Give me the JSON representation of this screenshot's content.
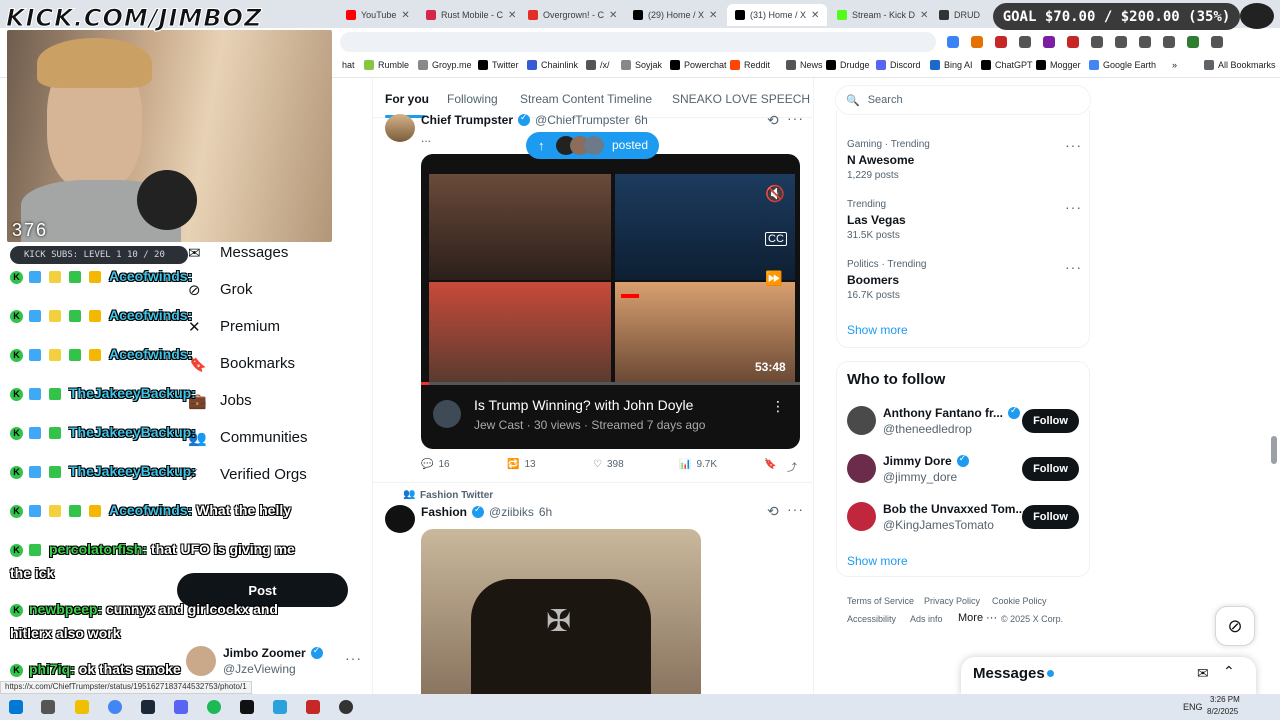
{
  "browser": {
    "tabs": [
      {
        "label": "YouTube",
        "color": "#ff0000",
        "active": false
      },
      {
        "label": "Rust Mobile - C",
        "color": "#d6264b",
        "active": false
      },
      {
        "label": "Overgrown! - C",
        "color": "#e52d27",
        "active": false
      },
      {
        "label": "(29) Home / X",
        "color": "#000000",
        "active": false
      },
      {
        "label": "(31) Home / X",
        "color": "#000000",
        "active": true
      },
      {
        "label": "Stream - Kick D",
        "color": "#53fc18",
        "active": false
      },
      {
        "label": "DRUD",
        "color": "#333333",
        "active": false
      }
    ],
    "bookmarks": [
      {
        "label": "hat",
        "color": "#888888"
      },
      {
        "label": "Rumble",
        "color": "#85c742"
      },
      {
        "label": "Groyp.me",
        "color": "#888888"
      },
      {
        "label": "Twitter",
        "color": "#000000"
      },
      {
        "label": "Chainlink",
        "color": "#375bd2"
      },
      {
        "label": "/x/",
        "color": "#555555"
      },
      {
        "label": "Soyjak",
        "color": "#888888"
      },
      {
        "label": "Powerchat",
        "color": "#000000"
      },
      {
        "label": "Reddit",
        "color": "#ff4500"
      },
      {
        "label": "News",
        "color": "#555555"
      },
      {
        "label": "Drudge",
        "color": "#000000"
      },
      {
        "label": "Discord",
        "color": "#5865f2"
      },
      {
        "label": "Bing AI",
        "color": "#1b6ac9"
      },
      {
        "label": "ChatGPT",
        "color": "#000000"
      },
      {
        "label": "Mogger",
        "color": "#000000"
      },
      {
        "label": "Google Earth",
        "color": "#4285f4"
      }
    ],
    "all_bookmarks": "All Bookmarks",
    "status_url": "https://x.com/ChiefTrumpster/status/1951627183744532753/photo/1"
  },
  "stream": {
    "logo_text": "KICK.COM/JIMBOZ",
    "viewers": "376",
    "subs_label": "KICK SUBS: LEVEL 1 10 / 20",
    "goal": "GOAL $70.00 / $200.00 (35%)",
    "goal_progress": 0.35,
    "chat": [
      {
        "user": "Aceofwinds:",
        "msg": "",
        "style": "cyan",
        "badges": [
          "#3fa9f5",
          "#f4d03f",
          "#33c24a",
          "#f5b800"
        ]
      },
      {
        "user": "Aceofwinds:",
        "msg": "",
        "style": "cyan",
        "badges": [
          "#3fa9f5",
          "#f4d03f",
          "#33c24a",
          "#f5b800"
        ]
      },
      {
        "user": "Aceofwinds:",
        "msg": "",
        "style": "cyan",
        "badges": [
          "#3fa9f5",
          "#f4d03f",
          "#33c24a",
          "#f5b800"
        ]
      },
      {
        "user": "TheJakeeyBackup:",
        "msg": "",
        "style": "cyan",
        "badges": [
          "#3fa9f5",
          "#33c24a"
        ]
      },
      {
        "user": "TheJakeeyBackup:",
        "msg": "",
        "style": "cyan",
        "badges": [
          "#3fa9f5",
          "#33c24a"
        ]
      },
      {
        "user": "TheJakeeyBackup:",
        "msg": "",
        "style": "cyan",
        "badges": [
          "#3fa9f5",
          "#33c24a"
        ]
      },
      {
        "user": "Aceofwinds:",
        "msg": "What the helly",
        "style": "cyan",
        "badges": [
          "#3fa9f5",
          "#f4d03f",
          "#33c24a",
          "#f5b800"
        ]
      },
      {
        "user": "percolatorfish:",
        "msg": "that UFO is giving me",
        "msg2": "the ick",
        "style": "green",
        "badges": [
          "#33c24a"
        ]
      },
      {
        "user": "newbpeep:",
        "msg": "cunnyx and girlcockx and",
        "msg2": "hitlerx also work",
        "style": "green",
        "badges": []
      },
      {
        "user": "phi7iq:",
        "msg": "ok thats smoke",
        "style": "green",
        "badges": []
      }
    ]
  },
  "x_nav": {
    "items": [
      {
        "label": "Messages",
        "icon": "envelope-icon"
      },
      {
        "label": "Grok",
        "icon": "grok-icon"
      },
      {
        "label": "Premium",
        "icon": "x-logo-icon"
      },
      {
        "label": "Bookmarks",
        "icon": "bookmark-icon"
      },
      {
        "label": "Jobs",
        "icon": "briefcase-icon"
      },
      {
        "label": "Communities",
        "icon": "people-icon"
      },
      {
        "label": "Verified Orgs",
        "icon": "lightning-icon"
      }
    ],
    "post_button": "Post",
    "account": {
      "name": "Jimbo Zoomer",
      "handle": "@JzeViewing"
    }
  },
  "feed": {
    "tabs": [
      "For you",
      "Following",
      "Stream Content Timeline",
      "SNEAKO LOVE SPEECH"
    ],
    "posted_pill": "posted",
    "post1": {
      "name": "Chief Trumpster",
      "handle": "@ChiefTrumpster",
      "time": "6h",
      "text": "...",
      "video_title": "Is Trump Winning? with John Doyle",
      "video_meta": "Jew Cast · 30 views · Streamed 7 days ago",
      "video_duration": "53:48",
      "replies": "16",
      "reposts": "13",
      "likes": "398",
      "views": "9.7K"
    },
    "post2": {
      "context": "Fashion Twitter",
      "name": "Fashion",
      "handle": "@ziibiks",
      "time": "6h"
    }
  },
  "right": {
    "search_placeholder": "Search",
    "trends": [
      {
        "meta": "Gaming · Trending",
        "name": "N Awesome",
        "count": "1,229 posts"
      },
      {
        "meta": "Trending",
        "name": "Las Vegas",
        "count": "31.5K posts"
      },
      {
        "meta": "Politics · Trending",
        "name": "Boomers",
        "count": "16.7K posts"
      }
    ],
    "show_more": "Show more",
    "who_to_follow_title": "Who to follow",
    "follow": [
      {
        "name": "Anthony Fantano fr...",
        "handle": "@theneedledrop",
        "avatar_color": "#4a4a4a"
      },
      {
        "name": "Jimmy Dore",
        "handle": "@jimmy_dore",
        "avatar_color": "#6b2b4a"
      },
      {
        "name": "Bob the Unvaxxed Tom...",
        "handle": "@KingJamesTomato",
        "avatar_color": "#c0263c"
      }
    ],
    "follow_label": "Follow",
    "footer": [
      "Terms of Service",
      "Privacy Policy",
      "Cookie Policy",
      "Accessibility",
      "Ads info",
      "More ···",
      "© 2025 X Corp."
    ],
    "messages_label": "Messages"
  },
  "taskbar": {
    "lang": "ENG",
    "time": "3:26 PM",
    "date": "8/2/2025"
  }
}
